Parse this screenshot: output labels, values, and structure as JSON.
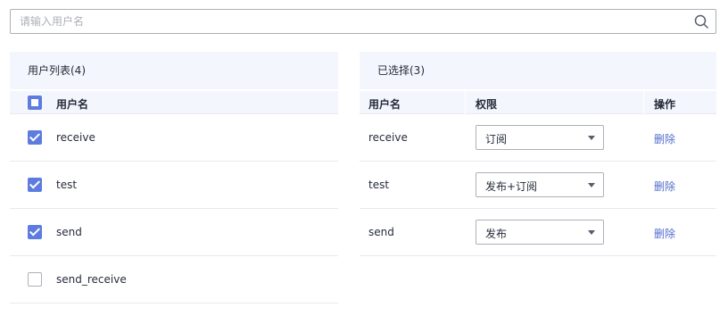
{
  "search": {
    "placeholder": "请输入用户名",
    "value": "",
    "icon": "search-icon"
  },
  "left": {
    "title": "用户列表(4)",
    "header": {
      "label": "用户名",
      "checkbox_state": "partial"
    },
    "rows": [
      {
        "name": "receive",
        "checked": true
      },
      {
        "name": "test",
        "checked": true
      },
      {
        "name": "send",
        "checked": true
      },
      {
        "name": "send_receive",
        "checked": false
      }
    ]
  },
  "right": {
    "title": "已选择(3)",
    "columns": [
      "用户名",
      "权限",
      "操作"
    ],
    "rows": [
      {
        "name": "receive",
        "permission": "订阅",
        "action": "删除"
      },
      {
        "name": "test",
        "permission": "发布+订阅",
        "action": "删除"
      },
      {
        "name": "send",
        "permission": "发布",
        "action": "删除"
      }
    ]
  },
  "colors": {
    "accent": "#5e7ce0",
    "link": "#526ecc",
    "header_bg": "#f3f6fc",
    "border": "#adb0b8"
  }
}
